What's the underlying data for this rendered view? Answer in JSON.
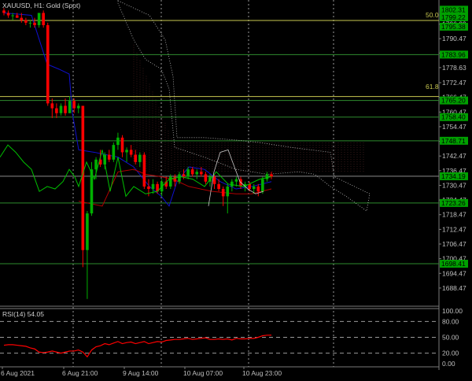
{
  "header": {
    "symbol_title": "XAUUSD, H1:  Gold (Spot)"
  },
  "rsi_panel": {
    "title": "RSI(14) 54.05",
    "levels": [
      100.0,
      80.0,
      50.0,
      20.0,
      0.0
    ],
    "level_labels": [
      "100.00",
      "80.00",
      "50.00",
      "20.00",
      "0.00"
    ]
  },
  "price_axis": {
    "tick_labels": [
      "1796.39",
      "1790.47",
      "1784.55",
      "1778.63",
      "1772.47",
      "1766.47",
      "1760.47",
      "1754.47",
      "1748.47",
      "1742.47",
      "1736.47",
      "1730.47",
      "1724.47",
      "1718.47",
      "1712.47",
      "1706.47",
      "1700.47",
      "1694.47",
      "1688.47"
    ],
    "highlighted_labels": [
      "1802.31",
      "1799.22",
      "1795.38",
      "1783.96",
      "1765.20",
      "1758.40",
      "1748.71",
      "1734.19",
      "1723.26",
      "1698.41"
    ]
  },
  "fib_labels": [
    "50.0",
    "61.8"
  ],
  "time_axis": {
    "labels": [
      "6 Aug 2021",
      "6 Aug 21:00",
      "9 Aug 14:00",
      "10 Aug 07:00",
      "10 Aug 23:00"
    ]
  },
  "colors": {
    "background": "#000000",
    "bull_candle": "#00b000",
    "bear_candle": "#ff0000",
    "fib_line": "#c8c850",
    "h_level": "#2e8b2e",
    "price_tag_bg": "#00a000",
    "ma_blue": "#1010d0",
    "ma_red": "#b00000",
    "osc_green": "#00c000",
    "rsi_line": "#ff0000",
    "cloud_dots": "#ffffff",
    "cloud_red_dots": "#ff7070"
  },
  "chart_data": {
    "type": "candlestick",
    "symbol": "XAUUSD",
    "timeframe": "H1",
    "ylim": [
      1682,
      1805
    ],
    "candles_approx": [
      {
        "o": 1802,
        "h": 1803,
        "l": 1800,
        "c": 1801
      },
      {
        "o": 1801,
        "h": 1802,
        "l": 1799,
        "c": 1800
      },
      {
        "o": 1800,
        "h": 1801,
        "l": 1798,
        "c": 1800
      },
      {
        "o": 1800,
        "h": 1801,
        "l": 1799,
        "c": 1799
      },
      {
        "o": 1799,
        "h": 1801,
        "l": 1797,
        "c": 1798
      },
      {
        "o": 1798,
        "h": 1799,
        "l": 1796,
        "c": 1797
      },
      {
        "o": 1797,
        "h": 1798,
        "l": 1795,
        "c": 1797
      },
      {
        "o": 1797,
        "h": 1799,
        "l": 1795,
        "c": 1796
      },
      {
        "o": 1796,
        "h": 1801,
        "l": 1795,
        "c": 1801
      },
      {
        "o": 1801,
        "h": 1802,
        "l": 1795,
        "c": 1796
      },
      {
        "o": 1796,
        "h": 1797,
        "l": 1763,
        "c": 1764
      },
      {
        "o": 1764,
        "h": 1766,
        "l": 1758,
        "c": 1762
      },
      {
        "o": 1762,
        "h": 1764,
        "l": 1758,
        "c": 1760
      },
      {
        "o": 1760,
        "h": 1764,
        "l": 1759,
        "c": 1763
      },
      {
        "o": 1763,
        "h": 1766,
        "l": 1759,
        "c": 1760
      },
      {
        "o": 1760,
        "h": 1767,
        "l": 1760,
        "c": 1765
      },
      {
        "o": 1765,
        "h": 1766,
        "l": 1760,
        "c": 1762
      },
      {
        "o": 1762,
        "h": 1764,
        "l": 1760,
        "c": 1763
      },
      {
        "o": 1763,
        "h": 1763,
        "l": 1697,
        "c": 1704
      },
      {
        "o": 1704,
        "h": 1720,
        "l": 1684,
        "c": 1719
      },
      {
        "o": 1719,
        "h": 1740,
        "l": 1718,
        "c": 1737
      },
      {
        "o": 1737,
        "h": 1742,
        "l": 1733,
        "c": 1741
      },
      {
        "o": 1741,
        "h": 1745,
        "l": 1738,
        "c": 1739
      },
      {
        "o": 1739,
        "h": 1744,
        "l": 1737,
        "c": 1743
      },
      {
        "o": 1743,
        "h": 1745,
        "l": 1740,
        "c": 1741
      },
      {
        "o": 1741,
        "h": 1748,
        "l": 1740,
        "c": 1747
      },
      {
        "o": 1747,
        "h": 1752,
        "l": 1745,
        "c": 1750
      },
      {
        "o": 1750,
        "h": 1751,
        "l": 1742,
        "c": 1744
      },
      {
        "o": 1744,
        "h": 1746,
        "l": 1740,
        "c": 1745
      },
      {
        "o": 1745,
        "h": 1747,
        "l": 1742,
        "c": 1743
      },
      {
        "o": 1743,
        "h": 1745,
        "l": 1739,
        "c": 1740
      },
      {
        "o": 1740,
        "h": 1744,
        "l": 1738,
        "c": 1743
      },
      {
        "o": 1743,
        "h": 1744,
        "l": 1729,
        "c": 1730
      },
      {
        "o": 1730,
        "h": 1733,
        "l": 1726,
        "c": 1729
      },
      {
        "o": 1729,
        "h": 1733,
        "l": 1727,
        "c": 1731
      },
      {
        "o": 1731,
        "h": 1732,
        "l": 1727,
        "c": 1728
      },
      {
        "o": 1728,
        "h": 1733,
        "l": 1726,
        "c": 1732
      },
      {
        "o": 1732,
        "h": 1734,
        "l": 1729,
        "c": 1730
      },
      {
        "o": 1730,
        "h": 1735,
        "l": 1729,
        "c": 1734
      },
      {
        "o": 1734,
        "h": 1735,
        "l": 1730,
        "c": 1732
      },
      {
        "o": 1732,
        "h": 1736,
        "l": 1731,
        "c": 1735
      },
      {
        "o": 1735,
        "h": 1737,
        "l": 1733,
        "c": 1734
      },
      {
        "o": 1734,
        "h": 1738,
        "l": 1733,
        "c": 1737
      },
      {
        "o": 1737,
        "h": 1738,
        "l": 1734,
        "c": 1735
      },
      {
        "o": 1735,
        "h": 1737,
        "l": 1733,
        "c": 1736
      },
      {
        "o": 1736,
        "h": 1738,
        "l": 1734,
        "c": 1735
      },
      {
        "o": 1735,
        "h": 1736,
        "l": 1731,
        "c": 1732
      },
      {
        "o": 1732,
        "h": 1735,
        "l": 1730,
        "c": 1734
      },
      {
        "o": 1734,
        "h": 1735,
        "l": 1729,
        "c": 1731
      },
      {
        "o": 1731,
        "h": 1733,
        "l": 1728,
        "c": 1729
      },
      {
        "o": 1729,
        "h": 1730,
        "l": 1722,
        "c": 1726
      },
      {
        "o": 1726,
        "h": 1731,
        "l": 1719,
        "c": 1730
      },
      {
        "o": 1730,
        "h": 1733,
        "l": 1728,
        "c": 1732
      },
      {
        "o": 1732,
        "h": 1734,
        "l": 1730,
        "c": 1733
      },
      {
        "o": 1733,
        "h": 1734,
        "l": 1729,
        "c": 1730
      },
      {
        "o": 1730,
        "h": 1732,
        "l": 1728,
        "c": 1731
      },
      {
        "o": 1731,
        "h": 1732,
        "l": 1728,
        "c": 1729
      },
      {
        "o": 1729,
        "h": 1731,
        "l": 1727,
        "c": 1730
      },
      {
        "o": 1730,
        "h": 1731,
        "l": 1726,
        "c": 1728
      },
      {
        "o": 1728,
        "h": 1734,
        "l": 1727,
        "c": 1733
      },
      {
        "o": 1733,
        "h": 1736,
        "l": 1732,
        "c": 1735
      },
      {
        "o": 1735,
        "h": 1736,
        "l": 1733,
        "c": 1734
      }
    ],
    "rsi_values": [
      35,
      36,
      36,
      35,
      34,
      33,
      30,
      28,
      22,
      21,
      22,
      24,
      22,
      20,
      22,
      24,
      24,
      26,
      22,
      13,
      26,
      32,
      34,
      38,
      36,
      39,
      42,
      38,
      40,
      41,
      38,
      40,
      42,
      38,
      40,
      42,
      41,
      44,
      45,
      46,
      46,
      47,
      48,
      46,
      47,
      48,
      49,
      46,
      46,
      47,
      46,
      47,
      45,
      48,
      47,
      47,
      48,
      48,
      50,
      53,
      54,
      54.05
    ]
  }
}
